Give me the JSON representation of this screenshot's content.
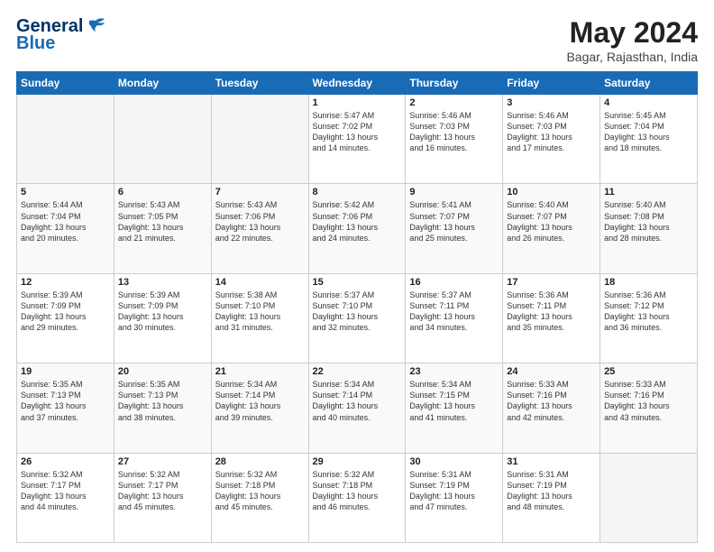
{
  "header": {
    "logo_line1": "General",
    "logo_line2": "Blue",
    "month": "May 2024",
    "location": "Bagar, Rajasthan, India"
  },
  "weekdays": [
    "Sunday",
    "Monday",
    "Tuesday",
    "Wednesday",
    "Thursday",
    "Friday",
    "Saturday"
  ],
  "weeks": [
    [
      {
        "day": "",
        "info": ""
      },
      {
        "day": "",
        "info": ""
      },
      {
        "day": "",
        "info": ""
      },
      {
        "day": "1",
        "info": "Sunrise: 5:47 AM\nSunset: 7:02 PM\nDaylight: 13 hours\nand 14 minutes."
      },
      {
        "day": "2",
        "info": "Sunrise: 5:46 AM\nSunset: 7:03 PM\nDaylight: 13 hours\nand 16 minutes."
      },
      {
        "day": "3",
        "info": "Sunrise: 5:46 AM\nSunset: 7:03 PM\nDaylight: 13 hours\nand 17 minutes."
      },
      {
        "day": "4",
        "info": "Sunrise: 5:45 AM\nSunset: 7:04 PM\nDaylight: 13 hours\nand 18 minutes."
      }
    ],
    [
      {
        "day": "5",
        "info": "Sunrise: 5:44 AM\nSunset: 7:04 PM\nDaylight: 13 hours\nand 20 minutes."
      },
      {
        "day": "6",
        "info": "Sunrise: 5:43 AM\nSunset: 7:05 PM\nDaylight: 13 hours\nand 21 minutes."
      },
      {
        "day": "7",
        "info": "Sunrise: 5:43 AM\nSunset: 7:06 PM\nDaylight: 13 hours\nand 22 minutes."
      },
      {
        "day": "8",
        "info": "Sunrise: 5:42 AM\nSunset: 7:06 PM\nDaylight: 13 hours\nand 24 minutes."
      },
      {
        "day": "9",
        "info": "Sunrise: 5:41 AM\nSunset: 7:07 PM\nDaylight: 13 hours\nand 25 minutes."
      },
      {
        "day": "10",
        "info": "Sunrise: 5:40 AM\nSunset: 7:07 PM\nDaylight: 13 hours\nand 26 minutes."
      },
      {
        "day": "11",
        "info": "Sunrise: 5:40 AM\nSunset: 7:08 PM\nDaylight: 13 hours\nand 28 minutes."
      }
    ],
    [
      {
        "day": "12",
        "info": "Sunrise: 5:39 AM\nSunset: 7:09 PM\nDaylight: 13 hours\nand 29 minutes."
      },
      {
        "day": "13",
        "info": "Sunrise: 5:39 AM\nSunset: 7:09 PM\nDaylight: 13 hours\nand 30 minutes."
      },
      {
        "day": "14",
        "info": "Sunrise: 5:38 AM\nSunset: 7:10 PM\nDaylight: 13 hours\nand 31 minutes."
      },
      {
        "day": "15",
        "info": "Sunrise: 5:37 AM\nSunset: 7:10 PM\nDaylight: 13 hours\nand 32 minutes."
      },
      {
        "day": "16",
        "info": "Sunrise: 5:37 AM\nSunset: 7:11 PM\nDaylight: 13 hours\nand 34 minutes."
      },
      {
        "day": "17",
        "info": "Sunrise: 5:36 AM\nSunset: 7:11 PM\nDaylight: 13 hours\nand 35 minutes."
      },
      {
        "day": "18",
        "info": "Sunrise: 5:36 AM\nSunset: 7:12 PM\nDaylight: 13 hours\nand 36 minutes."
      }
    ],
    [
      {
        "day": "19",
        "info": "Sunrise: 5:35 AM\nSunset: 7:13 PM\nDaylight: 13 hours\nand 37 minutes."
      },
      {
        "day": "20",
        "info": "Sunrise: 5:35 AM\nSunset: 7:13 PM\nDaylight: 13 hours\nand 38 minutes."
      },
      {
        "day": "21",
        "info": "Sunrise: 5:34 AM\nSunset: 7:14 PM\nDaylight: 13 hours\nand 39 minutes."
      },
      {
        "day": "22",
        "info": "Sunrise: 5:34 AM\nSunset: 7:14 PM\nDaylight: 13 hours\nand 40 minutes."
      },
      {
        "day": "23",
        "info": "Sunrise: 5:34 AM\nSunset: 7:15 PM\nDaylight: 13 hours\nand 41 minutes."
      },
      {
        "day": "24",
        "info": "Sunrise: 5:33 AM\nSunset: 7:16 PM\nDaylight: 13 hours\nand 42 minutes."
      },
      {
        "day": "25",
        "info": "Sunrise: 5:33 AM\nSunset: 7:16 PM\nDaylight: 13 hours\nand 43 minutes."
      }
    ],
    [
      {
        "day": "26",
        "info": "Sunrise: 5:32 AM\nSunset: 7:17 PM\nDaylight: 13 hours\nand 44 minutes."
      },
      {
        "day": "27",
        "info": "Sunrise: 5:32 AM\nSunset: 7:17 PM\nDaylight: 13 hours\nand 45 minutes."
      },
      {
        "day": "28",
        "info": "Sunrise: 5:32 AM\nSunset: 7:18 PM\nDaylight: 13 hours\nand 45 minutes."
      },
      {
        "day": "29",
        "info": "Sunrise: 5:32 AM\nSunset: 7:18 PM\nDaylight: 13 hours\nand 46 minutes."
      },
      {
        "day": "30",
        "info": "Sunrise: 5:31 AM\nSunset: 7:19 PM\nDaylight: 13 hours\nand 47 minutes."
      },
      {
        "day": "31",
        "info": "Sunrise: 5:31 AM\nSunset: 7:19 PM\nDaylight: 13 hours\nand 48 minutes."
      },
      {
        "day": "",
        "info": ""
      }
    ]
  ]
}
